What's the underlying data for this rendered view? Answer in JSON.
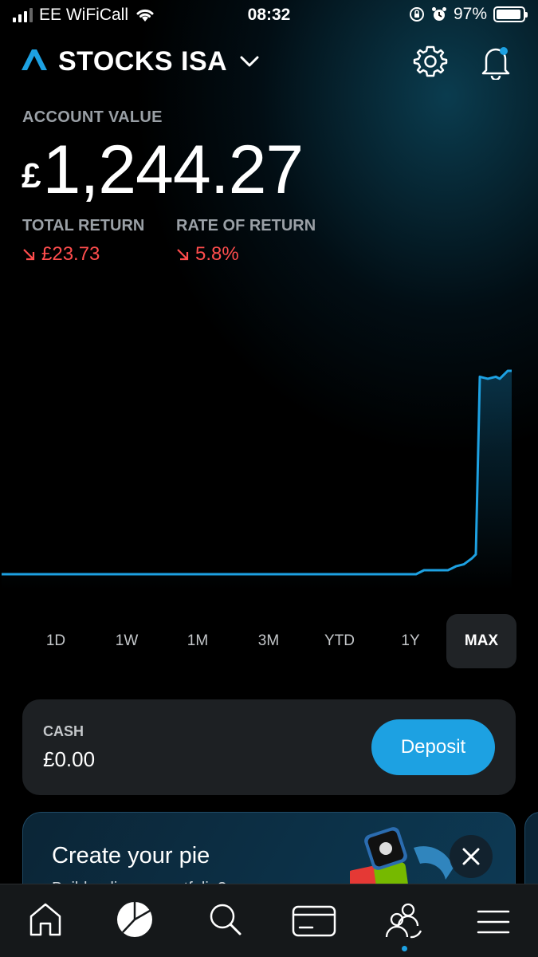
{
  "status_bar": {
    "carrier": "EE WiFiCall",
    "time": "08:32",
    "battery": "97%"
  },
  "header": {
    "account_name": "STOCKS ISA",
    "brand_logo": "trading212-logo-icon"
  },
  "account": {
    "label": "ACCOUNT VALUE",
    "currency_symbol": "£",
    "amount": "1,244.27",
    "total_return_label": "TOTAL RETURN",
    "total_return_value": "£23.73",
    "rate_of_return_label": "RATE OF RETURN",
    "rate_of_return_value": "5.8%",
    "return_direction": "down",
    "negative_color": "#ff4d4d"
  },
  "chart_data": {
    "type": "line",
    "series_color": "#1da1e2",
    "x": [
      0,
      100,
      200,
      300,
      400,
      500,
      520,
      530,
      540,
      550,
      560,
      565,
      570,
      580,
      590,
      595,
      600,
      610,
      620,
      625,
      630,
      635,
      640
    ],
    "y": [
      0,
      0,
      0,
      0,
      0,
      0,
      0,
      2,
      2,
      2,
      2,
      3,
      4,
      5,
      8,
      10,
      100,
      99,
      100,
      99,
      101,
      103,
      103
    ]
  },
  "ranges": {
    "options": [
      "1D",
      "1W",
      "1M",
      "3M",
      "YTD",
      "1Y",
      "MAX"
    ],
    "selected": "MAX"
  },
  "cash": {
    "label": "CASH",
    "value": "£0.00",
    "deposit_label": "Deposit",
    "accent": "#1da1e2"
  },
  "promo": {
    "title": "Create your pie",
    "subtitle": "Build a diverse portfolio?"
  },
  "bottom_nav": {
    "items": [
      "home-icon",
      "portfolio-pie-icon",
      "search-icon",
      "card-icon",
      "community-icon",
      "menu-icon"
    ],
    "active": "portfolio-pie-icon"
  }
}
